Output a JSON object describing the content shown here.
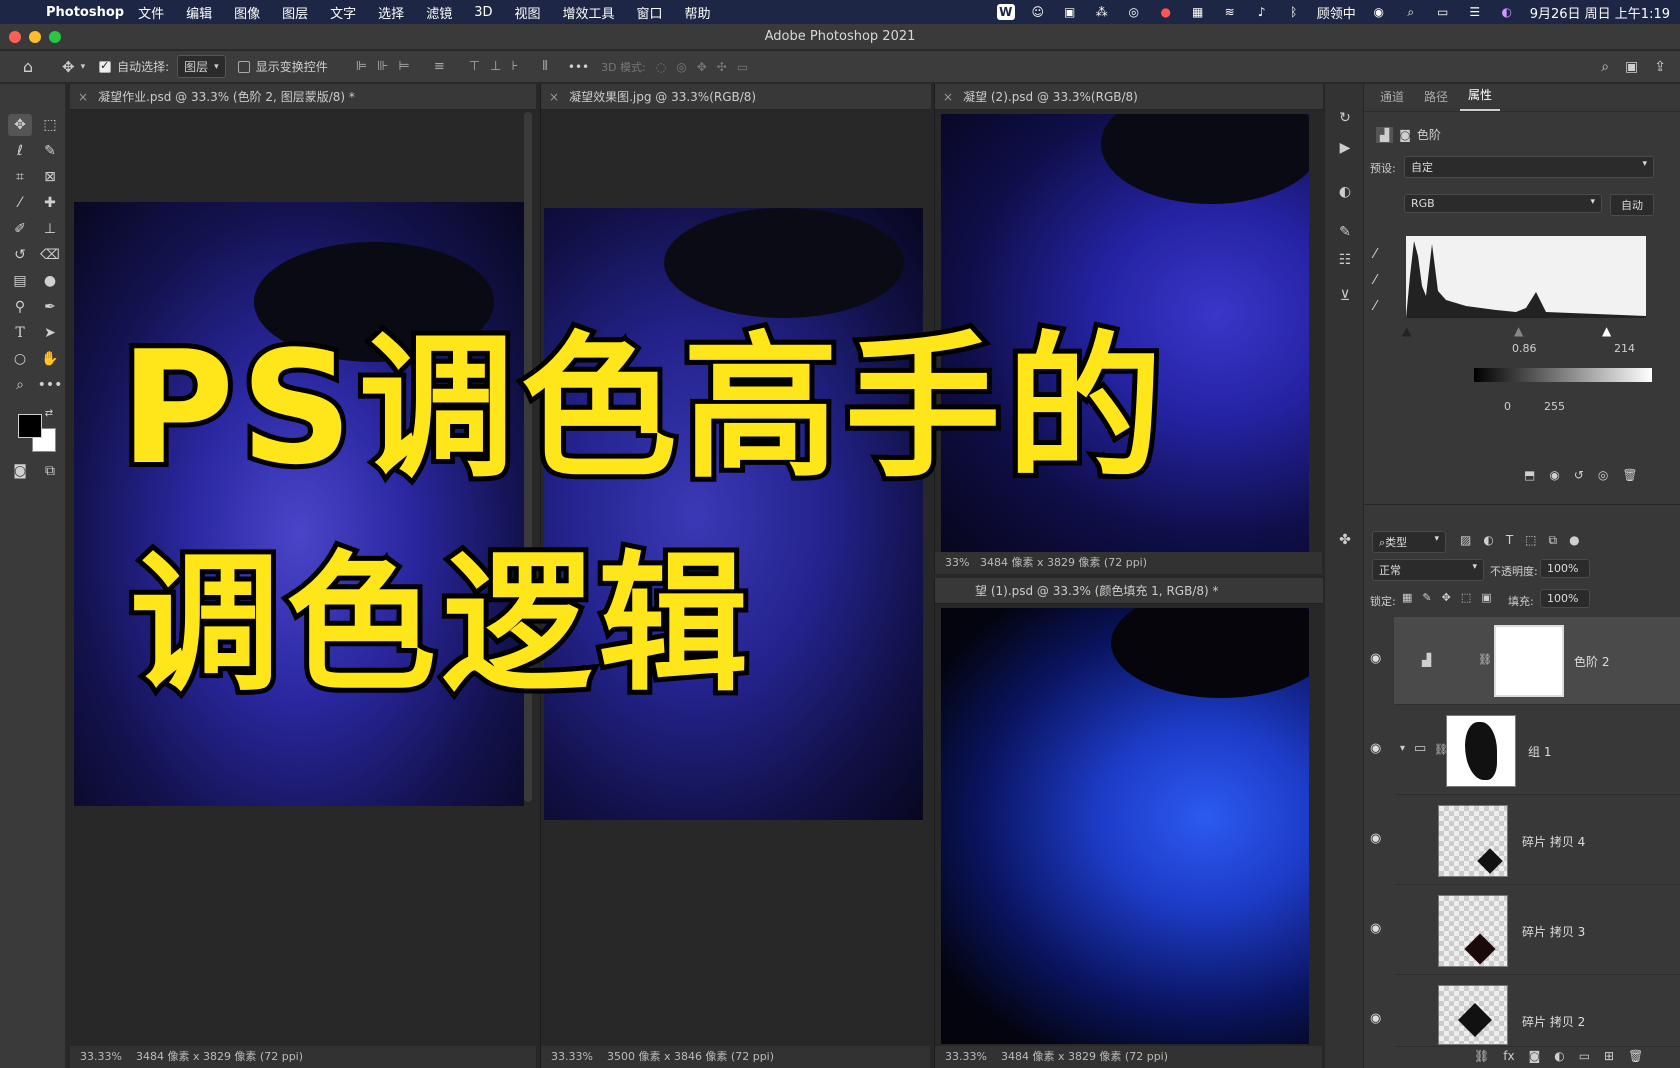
{
  "menubar": {
    "app": "Photoshop",
    "items": [
      "文件",
      "编辑",
      "图像",
      "图层",
      "文字",
      "选择",
      "滤镜",
      "3D",
      "视图",
      "增效工具",
      "窗口",
      "帮助"
    ],
    "right": {
      "user": "顾领中",
      "datetime": "9月26日 周日 上午1:19"
    }
  },
  "window": {
    "title": "Adobe Photoshop 2021"
  },
  "options": {
    "auto_select_label": "自动选择:",
    "auto_select_value": "图层",
    "show_transform_label": "显示变换控件",
    "mode_3d_label": "3D 模式:"
  },
  "documents": [
    {
      "tab": "凝望作业.psd @ 33.3% (色阶 2, 图层蒙版/8) *",
      "zoom": "33.33%",
      "info": "3484 像素 x 3829 像素 (72 ppi)"
    },
    {
      "tab": "凝望效果图.jpg @ 33.3%(RGB/8)",
      "zoom": "33.33%",
      "info": "3500 像素 x 3846 像素 (72 ppi)"
    },
    {
      "tab": "凝望 (2).psd @ 33.3%(RGB/8)",
      "zoom": "33%",
      "info": "3484 像素 x 3829 像素 (72 ppi)"
    },
    {
      "tab": "望 (1).psd @ 33.3% (颜色填充 1, RGB/8) *",
      "zoom": "33.33%",
      "info": "3484 像素 x 3829 像素 (72 ppi)"
    }
  ],
  "properties": {
    "tabs": [
      "通道",
      "路径",
      "属性"
    ],
    "adjust_label": "色阶",
    "preset_label": "预设:",
    "preset_value": "自定",
    "channel": "RGB",
    "auto_button": "自动",
    "input_mid": "0.86",
    "input_high": "214",
    "output_low": "0",
    "output_high": "255"
  },
  "layers_panel": {
    "filter_label": "类型",
    "blend_mode": "正常",
    "opacity_label": "不透明度:",
    "opacity": "100%",
    "lock_label": "锁定:",
    "fill_label": "填充:",
    "fill": "100%",
    "layers": [
      "色阶 2",
      "组 1",
      "碎片 拷贝 4",
      "碎片 拷贝 3",
      "碎片 拷贝 2"
    ]
  },
  "overlay": {
    "line1": "PS调色高手的",
    "line2": "调色逻辑"
  },
  "colors": {
    "title_yellow": "#ffe61a",
    "photo_blue": "#2a2fb8"
  }
}
